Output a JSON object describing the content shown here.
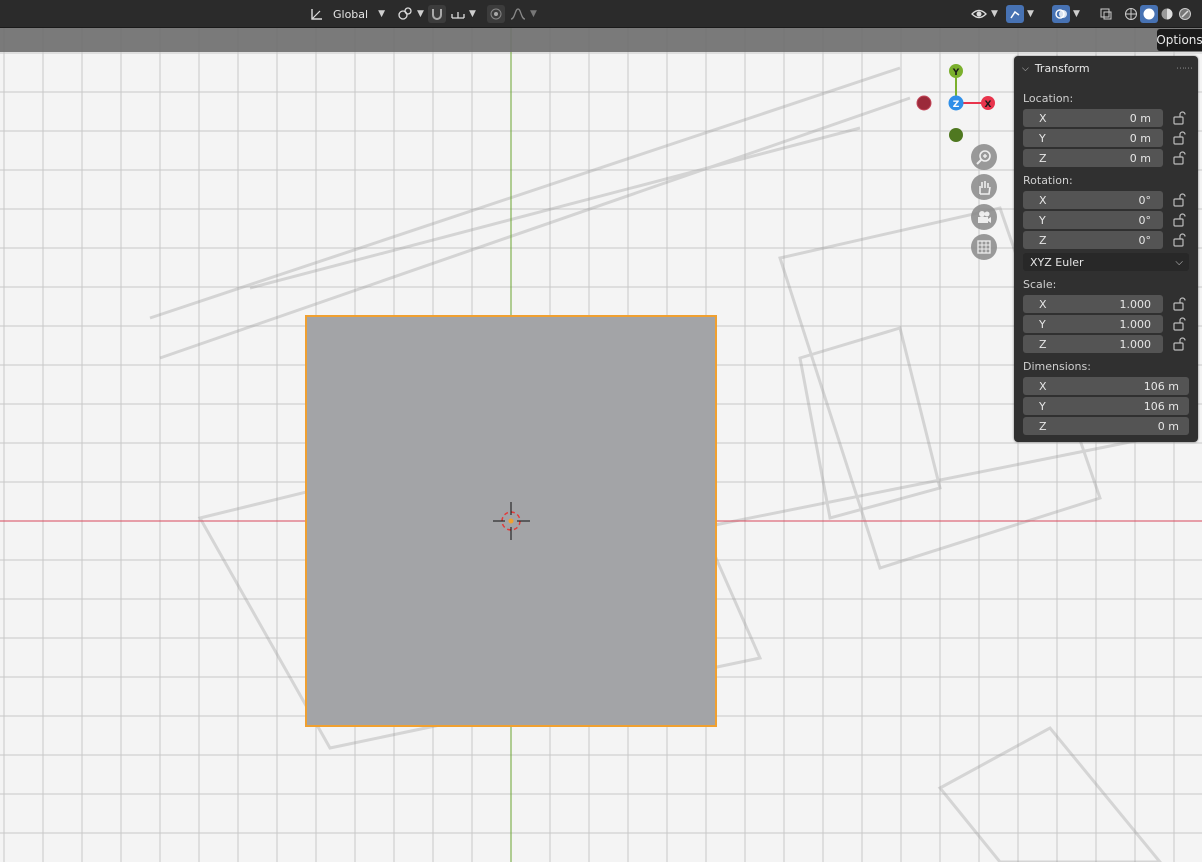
{
  "header": {
    "transform_orientation": "Global",
    "options_tab": "Options"
  },
  "panel": {
    "title": "Transform",
    "location_label": "Location:",
    "location": [
      {
        "axis": "X",
        "value": "0 m"
      },
      {
        "axis": "Y",
        "value": "0 m"
      },
      {
        "axis": "Z",
        "value": "0 m"
      }
    ],
    "rotation_label": "Rotation:",
    "rotation": [
      {
        "axis": "X",
        "value": "0°"
      },
      {
        "axis": "Y",
        "value": "0°"
      },
      {
        "axis": "Z",
        "value": "0°"
      }
    ],
    "rotation_mode": "XYZ Euler",
    "scale_label": "Scale:",
    "scale": [
      {
        "axis": "X",
        "value": "1.000"
      },
      {
        "axis": "Y",
        "value": "1.000"
      },
      {
        "axis": "Z",
        "value": "1.000"
      }
    ],
    "dimensions_label": "Dimensions:",
    "dimensions": [
      {
        "axis": "X",
        "value": "106 m"
      },
      {
        "axis": "Y",
        "value": "106 m"
      },
      {
        "axis": "Z",
        "value": "0 m"
      }
    ]
  },
  "gizmo": {
    "y_label": "Y",
    "z_label": "Z",
    "x_label": "X",
    "colors": {
      "x": "#e8344c",
      "y": "#7bb02d",
      "z": "#2f8fe8"
    }
  },
  "colors": {
    "selection_outline": "#f0a030",
    "plane_fill": "#a3a4a7",
    "x_axis_line": "#d9485b",
    "y_axis_line": "#6aa530"
  }
}
